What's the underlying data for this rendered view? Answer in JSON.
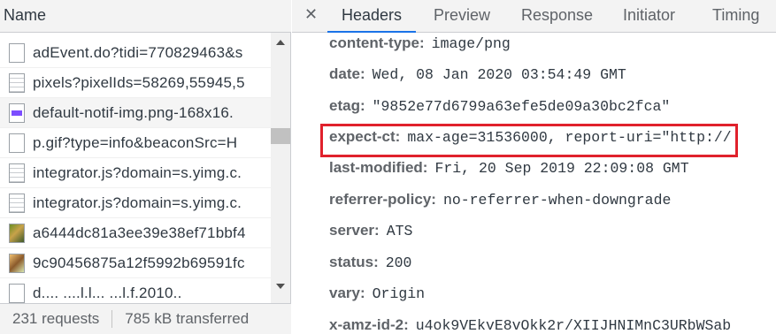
{
  "left": {
    "header_label": "Name",
    "requests": [
      {
        "icon": "doc-icon",
        "name": "adEvent.do?tidi=770829463&s"
      },
      {
        "icon": "script-icon",
        "name": "pixels?pixelIds=58269,55945,5"
      },
      {
        "icon": "image-icon",
        "name": "default-notif-img.png-168x16."
      },
      {
        "icon": "doc-icon",
        "name": "p.gif?type=info&beaconSrc=H"
      },
      {
        "icon": "script-icon",
        "name": "integrator.js?domain=s.yimg.c."
      },
      {
        "icon": "script-icon",
        "name": "integrator.js?domain=s.yimg.c."
      },
      {
        "icon": "photo-icon",
        "name": "a6444dc81a3ee39e38ef71bbf4"
      },
      {
        "icon": "photo-icon",
        "name": "9c90456875a12f5992b69591fc"
      },
      {
        "icon": "doc-icon",
        "name": "d.... ....l.l... ...l.f.2010.."
      }
    ],
    "status": {
      "requests": "231 requests",
      "transferred": "785 kB transferred"
    }
  },
  "right": {
    "close_glyph": "✕",
    "tabs": [
      "Headers",
      "Preview",
      "Response",
      "Initiator",
      "Timing"
    ],
    "active_tab": "Headers",
    "headers": [
      {
        "name": "content-type:",
        "value": "image/png"
      },
      {
        "name": "date:",
        "value": "Wed, 08 Jan 2020 03:54:49 GMT"
      },
      {
        "name": "etag:",
        "value": "\"9852e77d6799a63efe5de09a30bc2fca\""
      },
      {
        "name": "expect-ct:",
        "value": "max-age=31536000, report-uri=\"http://"
      },
      {
        "name": "last-modified:",
        "value": "Fri, 20 Sep 2019 22:09:08 GMT"
      },
      {
        "name": "referrer-policy:",
        "value": "no-referrer-when-downgrade"
      },
      {
        "name": "server:",
        "value": "ATS"
      },
      {
        "name": "status:",
        "value": "200"
      },
      {
        "name": "vary:",
        "value": "Origin"
      },
      {
        "name": "x-amz-id-2:",
        "value": "u4ok9VEkvE8vOkk2r/XIIJHNIMnC3URbWSab"
      }
    ],
    "highlighted_header": "last-modified:",
    "highlight_color": "#e0212c"
  },
  "colors": {
    "accent": "#1a73e8",
    "header_name": "#5f6368",
    "text": "#303942"
  }
}
